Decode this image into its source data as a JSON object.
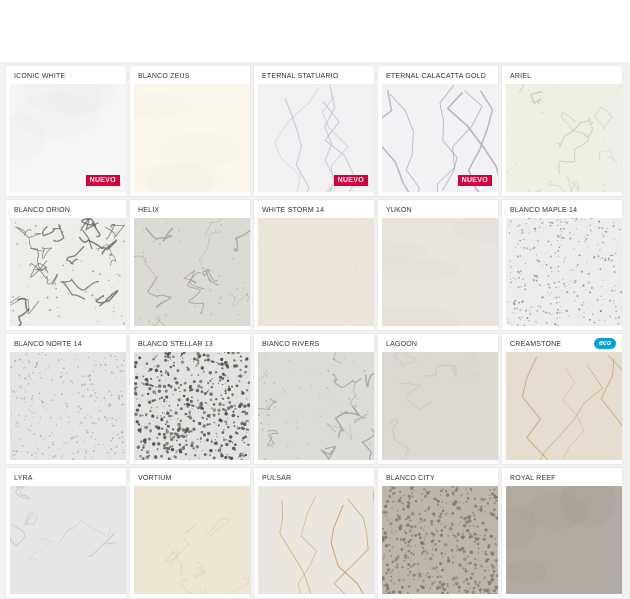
{
  "grid": {
    "items": [
      {
        "name": "ICONIC WHITE",
        "badge": "NUEVO",
        "colors": {
          "base": "#f6f5f6",
          "accent": "#e9e8ea"
        },
        "texture": "plain"
      },
      {
        "name": "BLANCO ZEUS",
        "badge": "",
        "colors": {
          "base": "#faf7ea",
          "accent": "#efeadb"
        },
        "texture": "plain"
      },
      {
        "name": "ETERNAL STATUARIO",
        "badge": "NUEVO",
        "colors": {
          "base": "#f1f1f3",
          "accent": "#c5c6cb"
        },
        "texture": "veins-light"
      },
      {
        "name": "ETERNAL CALACATTA GOLD",
        "badge": "NUEVO",
        "colors": {
          "base": "#f2f2f4",
          "accent": "#a9aab1"
        },
        "texture": "veins-strong"
      },
      {
        "name": "ARIEL",
        "badge": "",
        "colors": {
          "base": "#eef0e3",
          "accent": "#c9c9c1"
        },
        "texture": "marble"
      },
      {
        "name": "BLANCO ORION",
        "badge": "",
        "colors": {
          "base": "#ededea",
          "accent": "#5c5b58"
        },
        "texture": "orion"
      },
      {
        "name": "HELIX",
        "badge": "",
        "colors": {
          "base": "#dcdad5",
          "accent": "#9e9b95"
        },
        "texture": "marble"
      },
      {
        "name": "WHITE STORM 14",
        "badge": "",
        "colors": {
          "base": "#eee5da",
          "accent": "#d9cfc2"
        },
        "texture": "speck-fine"
      },
      {
        "name": "YUKON",
        "badge": "",
        "colors": {
          "base": "#e8e4dd",
          "accent": "#d6d0c7"
        },
        "texture": "plain"
      },
      {
        "name": "BLANCO MAPLE 14",
        "badge": "",
        "colors": {
          "base": "#ededed",
          "accent": "#8f8f8f"
        },
        "texture": "speck"
      },
      {
        "name": "BLANCO NORTE 14",
        "badge": "",
        "colors": {
          "base": "#e3e4e5",
          "accent": "#a9aaab"
        },
        "texture": "speck"
      },
      {
        "name": "BLANCO STELLAR 13",
        "badge": "",
        "colors": {
          "base": "#e2e2e0",
          "accent": "#4a4a48"
        },
        "texture": "speck-heavy"
      },
      {
        "name": "BIANCO RIVERS",
        "badge": "",
        "colors": {
          "base": "#dcdbd7",
          "accent": "#9a9893"
        },
        "texture": "marble"
      },
      {
        "name": "LAGOON",
        "badge": "",
        "colors": {
          "base": "#dcd9d2",
          "accent": "#c0bcb4"
        },
        "texture": "marble-soft"
      },
      {
        "name": "CREAMSTONE",
        "badge": "",
        "eco": "eco",
        "colors": {
          "base": "#e4ddd0",
          "accent": "#c29b61"
        },
        "texture": "veins-gold"
      },
      {
        "name": "LYRA",
        "badge": "",
        "colors": {
          "base": "#e7e6e4",
          "accent": "#b6b4b1"
        },
        "texture": "marble-soft"
      },
      {
        "name": "VORTIUM",
        "badge": "",
        "colors": {
          "base": "#ece5d2",
          "accent": "#d3c7ab"
        },
        "texture": "marble-soft"
      },
      {
        "name": "PULSAR",
        "badge": "",
        "colors": {
          "base": "#ebe6dd",
          "accent": "#c89c5a"
        },
        "texture": "veins-gold"
      },
      {
        "name": "BLANCO CITY",
        "badge": "",
        "colors": {
          "base": "#bdb6a9",
          "accent": "#7f786d"
        },
        "texture": "speck-heavy"
      },
      {
        "name": "ROYAL REEF",
        "badge": "",
        "colors": {
          "base": "#b2aaa0",
          "accent": "#9c958c"
        },
        "texture": "plain"
      }
    ]
  }
}
